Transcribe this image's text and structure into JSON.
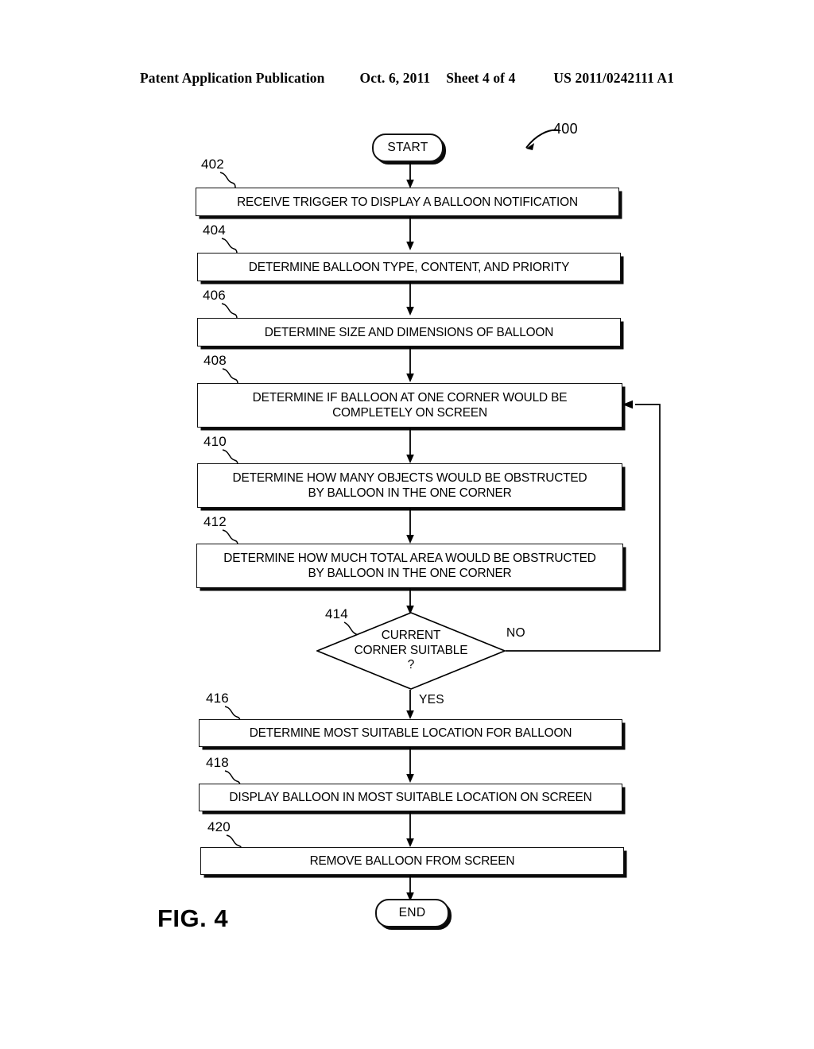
{
  "header": {
    "publication": "Patent Application Publication",
    "date": "Oct. 6, 2011",
    "sheet": "Sheet 4 of 4",
    "pub_number": "US 2011/0242111 A1"
  },
  "figure": {
    "caption": "FIG. 4",
    "id_label": "400",
    "ink_color": "#000000",
    "background_color": "#ffffff"
  },
  "flowchart": {
    "start_label": "START",
    "end_label": "END",
    "yes_label": "YES",
    "no_label": "NO",
    "steps": [
      {
        "ref": "402",
        "text": "RECEIVE TRIGGER TO DISPLAY A BALLOON NOTIFICATION"
      },
      {
        "ref": "404",
        "text": "DETERMINE BALLOON TYPE, CONTENT, AND PRIORITY"
      },
      {
        "ref": "406",
        "text": "DETERMINE SIZE AND DIMENSIONS OF BALLOON"
      },
      {
        "ref": "408",
        "text": "DETERMINE IF BALLOON AT ONE CORNER WOULD BE\nCOMPLETELY ON SCREEN"
      },
      {
        "ref": "410",
        "text": "DETERMINE HOW MANY OBJECTS WOULD BE OBSTRUCTED\nBY BALLOON IN THE ONE CORNER"
      },
      {
        "ref": "412",
        "text": "DETERMINE HOW MUCH TOTAL AREA WOULD BE OBSTRUCTED\nBY BALLOON IN THE ONE CORNER"
      },
      {
        "ref": "416",
        "text": "DETERMINE MOST SUITABLE LOCATION FOR BALLOON"
      },
      {
        "ref": "418",
        "text": "DISPLAY BALLOON IN MOST SUITABLE LOCATION ON SCREEN"
      },
      {
        "ref": "420",
        "text": "REMOVE BALLOON FROM SCREEN"
      }
    ],
    "decision": {
      "ref": "414",
      "line1": "CURRENT",
      "line2": "CORNER SUITABLE",
      "line3": "?"
    }
  }
}
